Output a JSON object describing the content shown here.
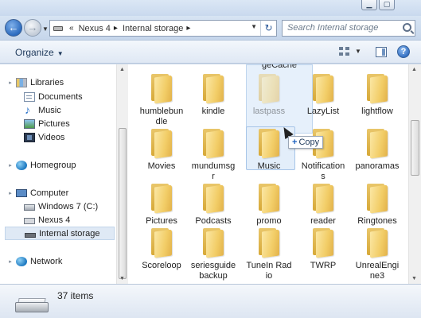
{
  "window": {
    "controls": [
      "minimize",
      "maximize"
    ]
  },
  "nav": {
    "back_glyph": "←",
    "forward_glyph": "→",
    "breadcrumb": [
      "Nexus 4",
      "Internal storage"
    ],
    "breadcrumb_prefix": "«",
    "search_placeholder": "Search Internal storage"
  },
  "toolbar": {
    "organize_label": "Organize",
    "help_glyph": "?"
  },
  "sidebar": {
    "items": [
      {
        "label": "Libraries",
        "icon": "library-icon"
      },
      {
        "label": "Documents",
        "icon": "documents-icon"
      },
      {
        "label": "Music",
        "icon": "music-icon"
      },
      {
        "label": "Pictures",
        "icon": "pictures-icon"
      },
      {
        "label": "Videos",
        "icon": "videos-icon"
      },
      {
        "label": "Homegroup",
        "icon": "homegroup-icon"
      },
      {
        "label": "Computer",
        "icon": "computer-icon"
      },
      {
        "label": "Windows 7 (C:)",
        "icon": "drive-icon"
      },
      {
        "label": "Nexus 4",
        "icon": "phone-icon"
      },
      {
        "label": "Internal storage",
        "icon": "storage-icon"
      },
      {
        "label": "Network",
        "icon": "network-icon"
      }
    ]
  },
  "content": {
    "partial_top_label": "geCache",
    "files": [
      {
        "name": "humblebundle"
      },
      {
        "name": "kindle"
      },
      {
        "name": "lastpass"
      },
      {
        "name": "LazyList"
      },
      {
        "name": "lightflow"
      },
      {
        "name": "Movies"
      },
      {
        "name": "mundumsgr"
      },
      {
        "name": "Music"
      },
      {
        "name": "Notifications"
      },
      {
        "name": "panoramas"
      },
      {
        "name": "Pictures"
      },
      {
        "name": "Podcasts"
      },
      {
        "name": "promo"
      },
      {
        "name": "reader"
      },
      {
        "name": "Ringtones"
      },
      {
        "name": "Scoreloop"
      },
      {
        "name": "seriesguidebackup"
      },
      {
        "name": "TuneIn Radio"
      },
      {
        "name": "TWRP"
      },
      {
        "name": "UnrealEngine3"
      }
    ],
    "drag_tooltip": "Copy",
    "drag_tooltip_plus": "+"
  },
  "status": {
    "item_count": "37 items"
  }
}
